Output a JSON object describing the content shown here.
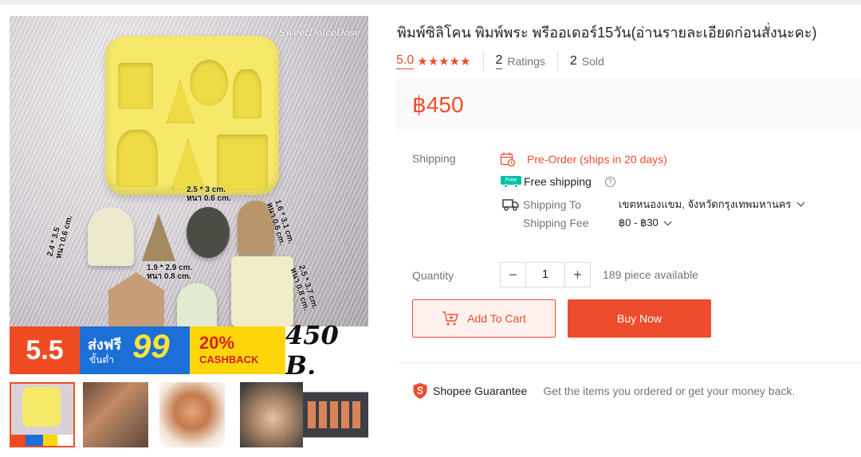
{
  "product": {
    "title": "พิมพ์ซิลิโคน พิมพ์พระ พรีออเดอร์15วัน(อ่านรายละเอียดก่อนสั่งนะคะ)",
    "rating": "5.0",
    "stars": 5,
    "ratings_count": "2",
    "ratings_label": "Ratings",
    "sold_count": "2",
    "sold_label": "Sold",
    "price": "฿450"
  },
  "gallery": {
    "watermark": "SweetDolceDose",
    "dimensions": {
      "top_center": "2.5 * 3 cm.\nหนา 0.6 cm.",
      "left": "2.4 * 3.5\nหนา 0.6 cm.",
      "middle": "1.9 * 2.9 cm.\nหนา 0.8 cm.",
      "right_top": "1.6 * 3.1 cm.\nหนา 0.6 cm.",
      "right_bottom": "2.5 * 3.7 cm.\nหนา 0.8 cm."
    },
    "banner": {
      "sale": "5.5",
      "ship_line1": "ส่งฟรี",
      "ship_line2": "ขั้นต่ำ",
      "ship_amount": "99",
      "coins_line1": "20%",
      "coins_line2": "CASHBACK",
      "price": "450 B."
    },
    "thumbnail_count": 5,
    "active_thumbnail": 1
  },
  "shipping": {
    "label": "Shipping",
    "preorder": "Pre-Order (ships in 20 days)",
    "free_badge": "Free",
    "free_shipping": "Free shipping",
    "to_label": "Shipping To",
    "to_value": "เขตหนองแขม, จังหวัดกรุงเทพมหานคร",
    "fee_label": "Shipping Fee",
    "fee_value": "฿0 - ฿30"
  },
  "quantity": {
    "label": "Quantity",
    "value": "1",
    "available": "189 piece available"
  },
  "actions": {
    "add_to_cart": "Add To Cart",
    "buy_now": "Buy Now"
  },
  "guarantee": {
    "title": "Shopee Guarantee",
    "text": "Get the items you ordered or get your money back."
  },
  "colors": {
    "accent": "#ee4d2d",
    "mold": "#f6e96a",
    "free_ship": "#00bfa5"
  }
}
